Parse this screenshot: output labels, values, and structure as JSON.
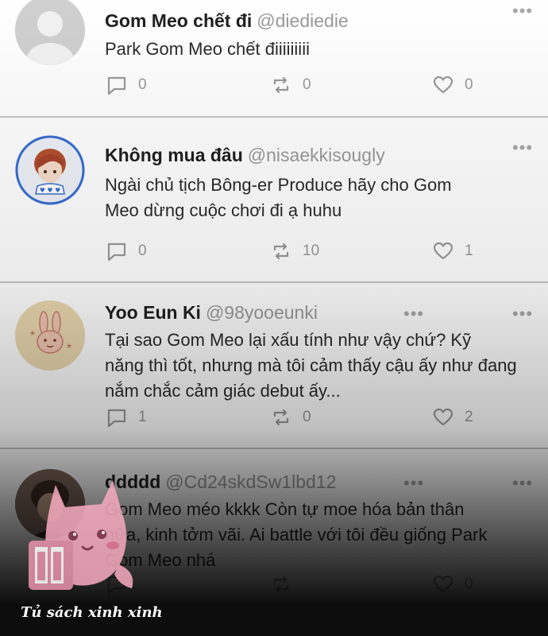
{
  "tweets": [
    {
      "name": "Gom Meo chết đi",
      "handle": "@diediedie",
      "text_lines": [
        "Park Gom Meo chết điiiiiiiii"
      ],
      "replies": "0",
      "retweets": "0",
      "likes": "0",
      "avatar": "default-avatar"
    },
    {
      "name": "Không mua đâu",
      "handle": "@nisaekkisougly",
      "text_lines": [
        "Ngài chủ tịch Bông-er Produce hãy cho Gom",
        "Meo dừng cuộc chơi đi ạ huhu"
      ],
      "replies": "0",
      "retweets": "10",
      "likes": "1",
      "avatar": "anime-boy-avatar"
    },
    {
      "name": "Yoo Eun Ki",
      "handle": "@98yooeunki",
      "text_lines": [
        "Tại sao Gom Meo lại xấu tính như vậy chứ? Kỹ",
        "năng thì tốt, nhưng mà tôi cảm thấy cậu ấy như đang",
        "nắm chắc cảm giác debut ấy..."
      ],
      "replies": "1",
      "retweets": "0",
      "likes": "2",
      "avatar": "bunny-avatar"
    },
    {
      "name": "ddddd",
      "handle": "@Cd24skdSw1lbd12",
      "text_lines": [
        "Gom Meo méo kkkk Còn tự moe hóa bản thân",
        "nữa, kinh tởm vãi. Ai battle với tôi đều giống Park",
        "Gom Meo nhá"
      ],
      "replies": "",
      "retweets": "",
      "likes": "0",
      "avatar": "photo-avatar"
    }
  ],
  "more_glyph": "•••",
  "watermark": {
    "text": "Tủ sách xinh xinh"
  },
  "colors": {
    "divider": "#c9c9c9",
    "icon": "#9a9a9a",
    "watermark_pink": "#f2a9bd"
  }
}
